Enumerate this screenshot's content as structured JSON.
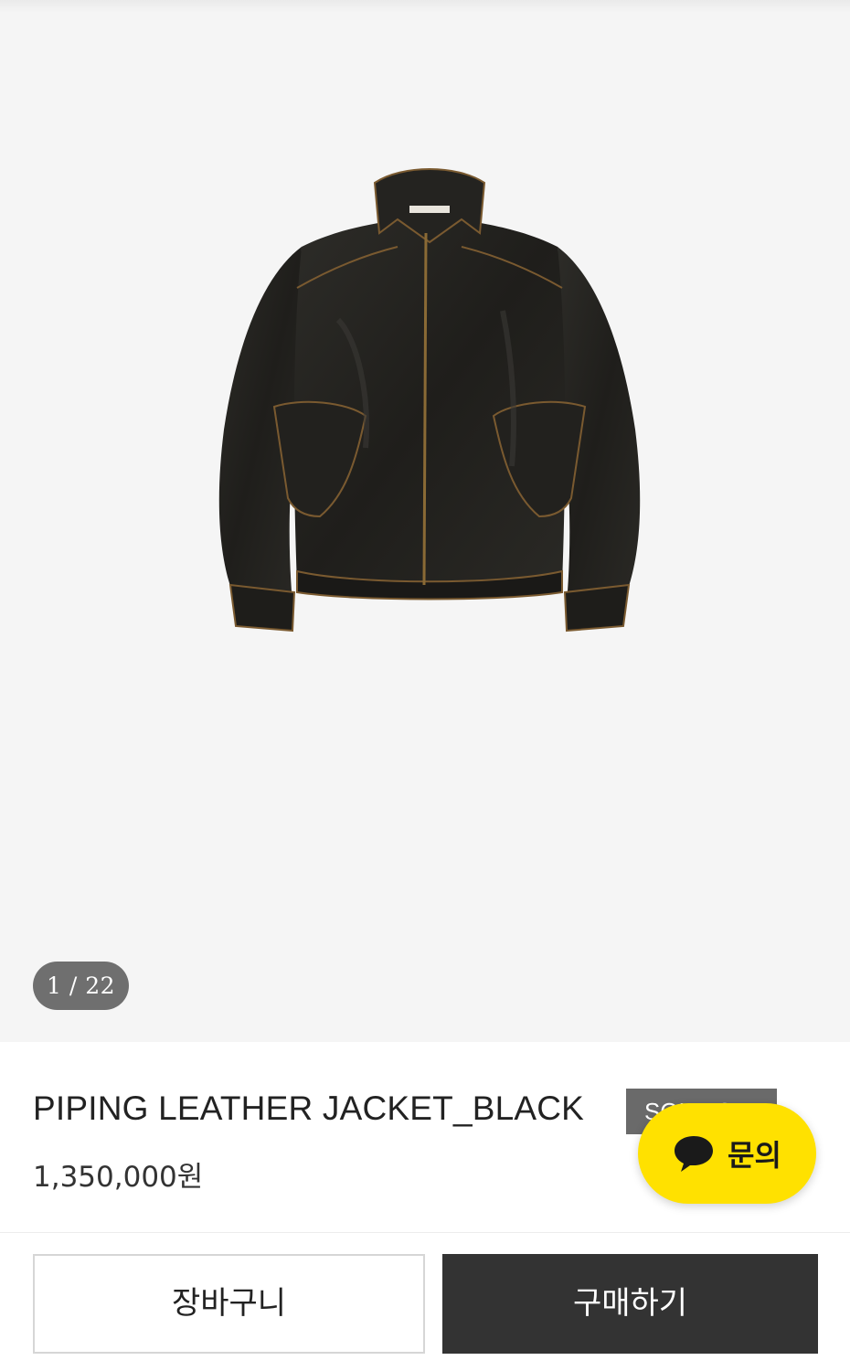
{
  "gallery": {
    "current_index": "1",
    "total": "22",
    "counter_text": "1 / 22",
    "image_alt": "product-photo-leather-jacket"
  },
  "product": {
    "name": "PIPING LEATHER JACKET_BLACK",
    "badge": "SOLD OUT",
    "price": "1,350,000원"
  },
  "chat": {
    "label": "문의",
    "icon": "chat-bubble-icon",
    "color": "#ffe100"
  },
  "actions": {
    "cart_label": "장바구니",
    "buy_label": "구매하기"
  },
  "colors": {
    "background": "#f5f5f5",
    "buy_button": "#333333",
    "badge": "#6a6a6a"
  }
}
